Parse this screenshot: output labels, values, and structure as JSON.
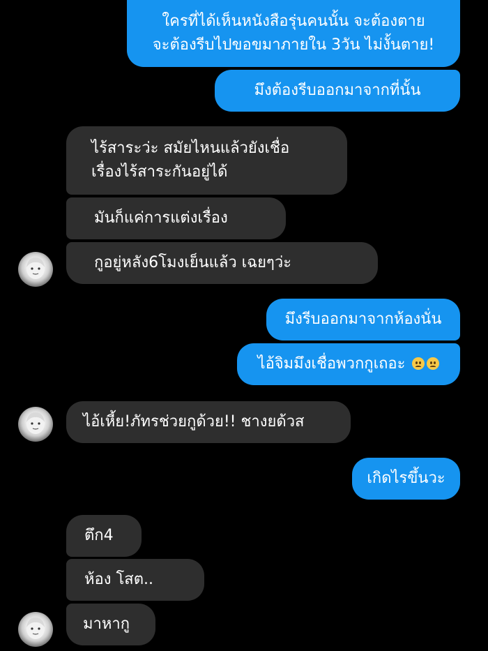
{
  "messages": [
    {
      "id": "m1",
      "side": "out",
      "lines": [
        "ใครที่ได้เห็นหนังสือรุ่นคนนั้น จะต้องตาย",
        "จะต้องรีบไปขอขมาภายใน  3วัน ไม่งั้นตาย!"
      ]
    },
    {
      "id": "m2",
      "side": "out",
      "lines": [
        "มึงต้องรีบออกมาจากที่นั้น"
      ]
    },
    {
      "id": "m3",
      "side": "in",
      "lines": [
        "ไร้สาระว่ะ สมัยไหนแล้วยังเชื่อ",
        "เรื่องไร้สาระกันอยู่ได้"
      ]
    },
    {
      "id": "m4",
      "side": "in",
      "lines": [
        "มันก็แค่การแต่งเรื่อง"
      ]
    },
    {
      "id": "m5",
      "side": "in",
      "lines": [
        "กูอยู่หลัง6โมงเย็นแล้ว  เฉยๆว่ะ"
      ]
    },
    {
      "id": "m6",
      "side": "out",
      "lines": [
        "มึงรีบออกมาจากห้องนั่น"
      ]
    },
    {
      "id": "m7",
      "side": "out",
      "lines": [
        "ไอ้จิมมึงเชื่อพวกกูเถอะ"
      ],
      "emoji": [
        "pleading-face-emoji",
        "worried-face-emoji"
      ]
    },
    {
      "id": "m8",
      "side": "in",
      "lines": [
        "ไอ้เหี้ย!ภัทรช่วยกูด้วย!! ชางยด้วส"
      ]
    },
    {
      "id": "m9",
      "side": "out",
      "lines": [
        "เกิดไรขึ้นวะ"
      ]
    },
    {
      "id": "m10",
      "side": "in",
      "lines": [
        "ตึก4"
      ]
    },
    {
      "id": "m11",
      "side": "in",
      "lines": [
        "ห้อง โสต.."
      ]
    },
    {
      "id": "m12",
      "side": "in",
      "lines": [
        "มาหากู"
      ]
    }
  ],
  "colors": {
    "background": "#000000",
    "outgoing_bubble": "#1694f0",
    "incoming_bubble": "#2e2e2e",
    "text": "#ffffff"
  },
  "avatar": {
    "icon": "contact-avatar-icon"
  }
}
